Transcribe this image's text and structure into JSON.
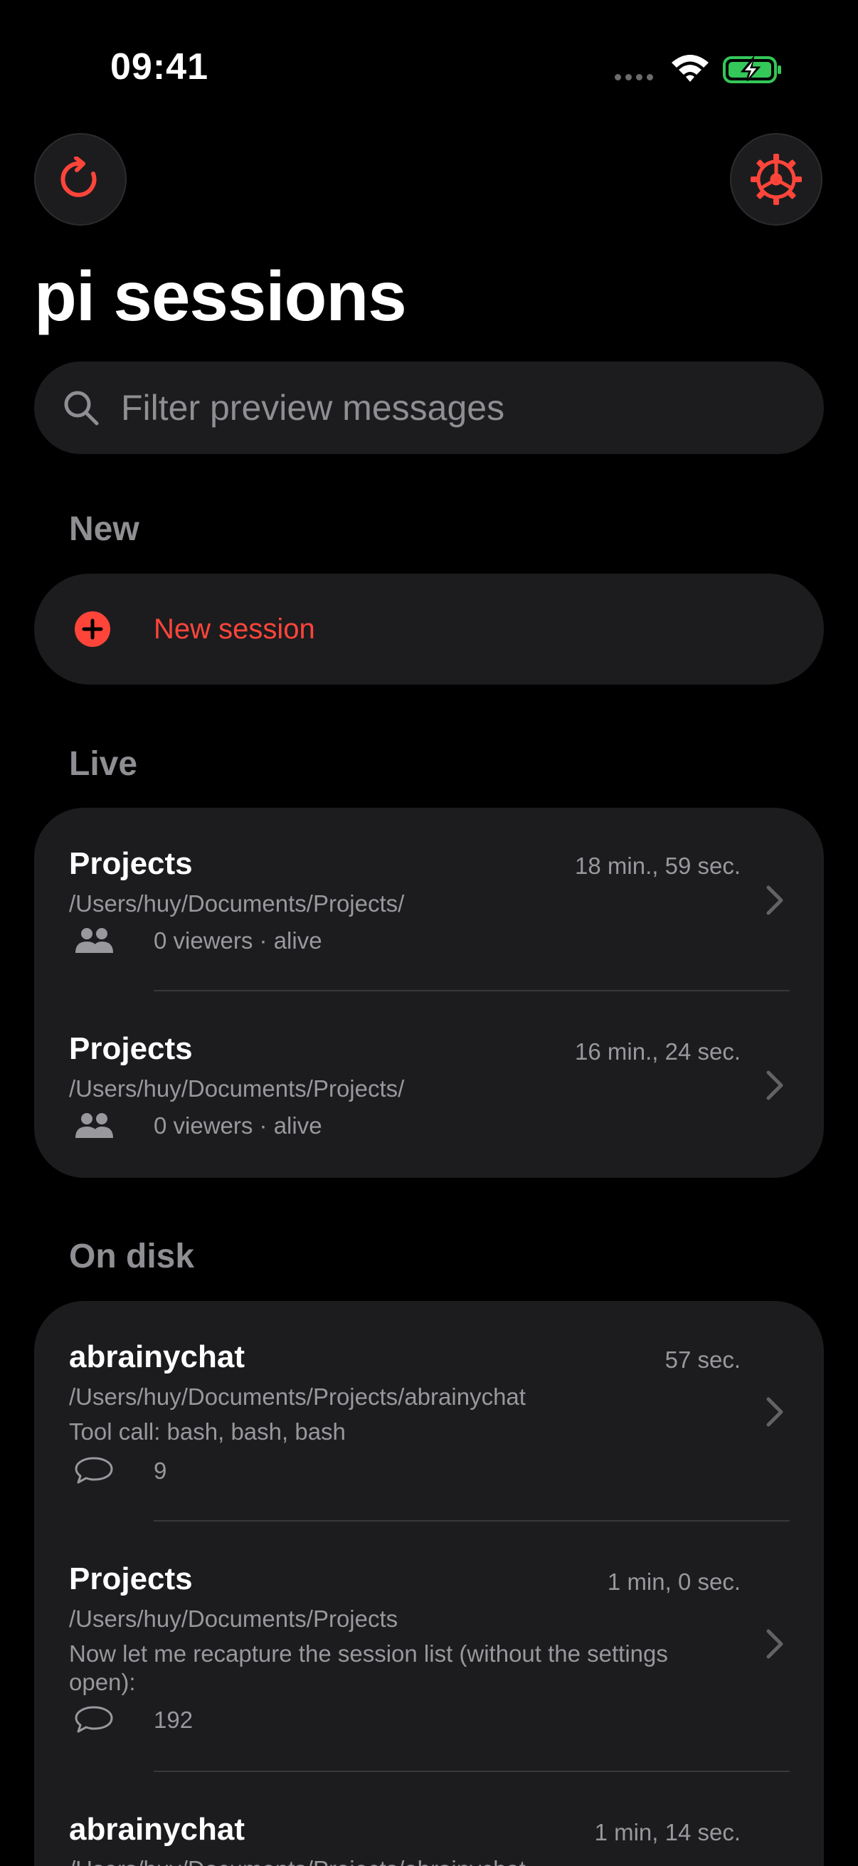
{
  "status_bar": {
    "time": "09:41"
  },
  "page_title": "pi sessions",
  "search": {
    "placeholder": "Filter preview messages"
  },
  "sections": {
    "new": {
      "header": "New",
      "new_session_label": "New session"
    },
    "live": {
      "header": "Live",
      "rows": [
        {
          "title": "Projects",
          "time": "18 min., 59 sec.",
          "path": "/Users/huy/Documents/Projects/",
          "meta": "0 viewers · alive"
        },
        {
          "title": "Projects",
          "time": "16 min., 24 sec.",
          "path": "/Users/huy/Documents/Projects/",
          "meta": "0 viewers · alive"
        }
      ]
    },
    "on_disk": {
      "header": "On disk",
      "rows": [
        {
          "title": "abrainychat",
          "time": "57 sec.",
          "path": "/Users/huy/Documents/Projects/abrainychat",
          "preview": "Tool call: bash, bash, bash",
          "count": "9"
        },
        {
          "title": "Projects",
          "time": "1 min, 0 sec.",
          "path": "/Users/huy/Documents/Projects",
          "preview": "Now let me recapture the session list (without the settings open):",
          "count": "192"
        },
        {
          "title": "abrainychat",
          "time": "1 min, 14 sec.",
          "path": "/Users/huy/Documents/Projects/abrainychat"
        }
      ]
    }
  },
  "colors": {
    "accent": "#ff453a",
    "background": "#000000",
    "card": "#1c1c1e",
    "secondary_text": "#98989d",
    "battery": "#34c759"
  },
  "icons": {
    "refresh": "refresh-icon",
    "settings": "gear-icon",
    "search": "search-icon",
    "new": "plus-circle-icon",
    "viewers": "people-icon",
    "messages": "chat-bubble-icon",
    "disclosure": "chevron-right-icon"
  }
}
